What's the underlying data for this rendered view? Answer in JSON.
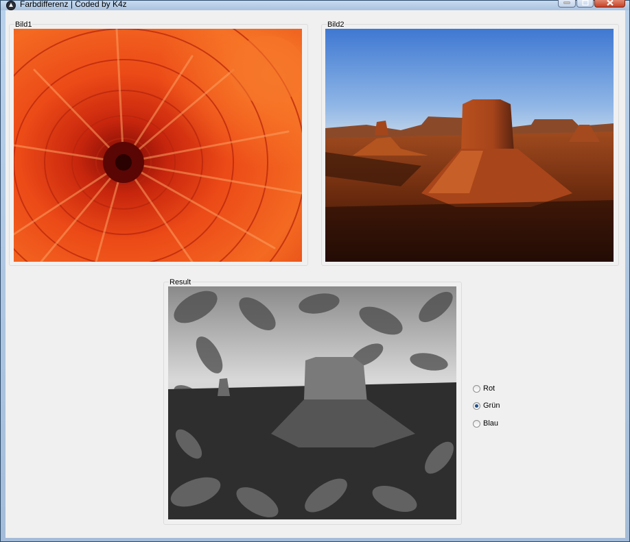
{
  "window": {
    "title": "Farbdifferenz | Coded by K4z"
  },
  "groups": {
    "bild1": {
      "label": "Bild1"
    },
    "bild2": {
      "label": "Bild2"
    },
    "result": {
      "label": "Result"
    }
  },
  "channels": {
    "options": [
      {
        "label": "Rot",
        "checked": false
      },
      {
        "label": "Grün",
        "checked": true
      },
      {
        "label": "Blau",
        "checked": false
      }
    ]
  },
  "colors": {
    "accent": "#1c4f8c",
    "flower_orange": "#e8501a",
    "desert_sky": "#5a8fd8",
    "desert_rock": "#9a3e16"
  }
}
